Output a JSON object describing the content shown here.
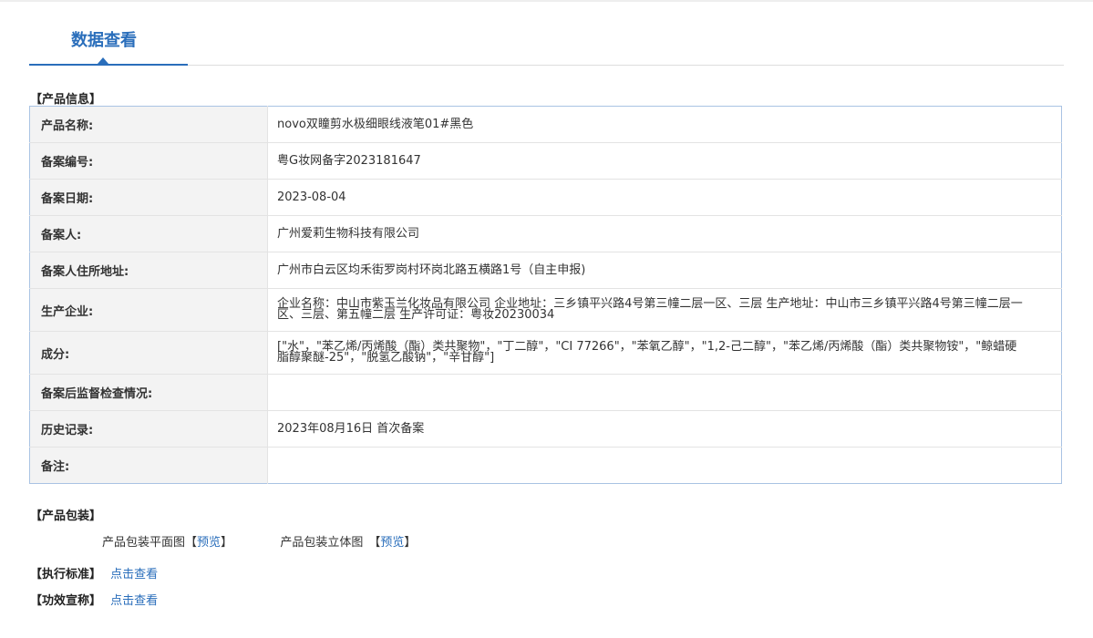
{
  "page": {
    "tab_title": "数据查看"
  },
  "product_info": {
    "heading": "【产品信息】",
    "rows": [
      {
        "label": "产品名称:",
        "value": "novo双瞳剪水极细眼线液笔01#黑色"
      },
      {
        "label": "备案编号:",
        "value": "粤G妆网备字2023181647"
      },
      {
        "label": "备案日期:",
        "value": "2023-08-04"
      },
      {
        "label": "备案人:",
        "value": "广州爱莉生物科技有限公司"
      },
      {
        "label": "备案人住所地址:",
        "value": "广州市白云区均禾街罗岗村环岗北路五横路1号（自主申报)"
      },
      {
        "label": "生产企业:",
        "value": "企业名称：中山市紫玉兰化妆品有限公司 企业地址：三乡镇平兴路4号第三幢二层一区、三层 生产地址：中山市三乡镇平兴路4号第三幢二层一区、三层、第五幢二层 生产许可证：粤妆20230034"
      },
      {
        "label": "成分:",
        "value": "[\"水\"，\"苯乙烯/丙烯酸（酯）类共聚物\"，\"丁二醇\"，\"CI 77266\"，\"苯氧乙醇\"，\"1,2-己二醇\"，\"苯乙烯/丙烯酸（酯）类共聚物铵\"，\"鲸蜡硬脂醇聚醚-25\"，\"脱氢乙酸钠\"，\"辛甘醇\"]"
      },
      {
        "label": "备案后监督检查情况:",
        "value": ""
      },
      {
        "label": "历史记录:",
        "value": "2023年08月16日 首次备案"
      },
      {
        "label": "备注:",
        "value": ""
      }
    ]
  },
  "packaging": {
    "heading": "【产品包装】",
    "flat_label": "产品包装平面图",
    "solid_label": "产品包装立体图",
    "bracket_open": "【",
    "bracket_close": "】",
    "preview_label": "预览"
  },
  "standard": {
    "heading": "【执行标准】",
    "link_label": "点击查看"
  },
  "efficacy": {
    "heading": "【功效宣称】",
    "link_label": "点击查看"
  },
  "colors": {
    "accent": "#2a6ebb",
    "table_border": "#a9c3e3",
    "label_bg": "#f3f3f3"
  }
}
